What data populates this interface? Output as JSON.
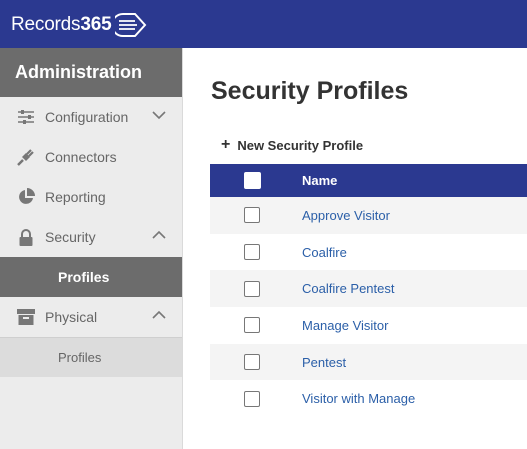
{
  "app": {
    "logo_text": "Records",
    "logo_number": "365"
  },
  "sidebar": {
    "heading": "Administration",
    "items": [
      {
        "label": "Configuration",
        "icon": "sliders-icon",
        "chevron": "down"
      },
      {
        "label": "Connectors",
        "icon": "plug-icon"
      },
      {
        "label": "Reporting",
        "icon": "pie-chart-icon"
      },
      {
        "label": "Security",
        "icon": "lock-icon",
        "chevron": "up"
      },
      {
        "label": "Profiles",
        "selected": true
      },
      {
        "label": "Physical",
        "icon": "archive-box-icon",
        "chevron": "up"
      },
      {
        "label": "Profiles"
      }
    ]
  },
  "main": {
    "title": "Security Profiles",
    "new_button_label": "New Security Profile",
    "table": {
      "columns": [
        "Name"
      ],
      "rows": [
        {
          "name": "Approve Visitor"
        },
        {
          "name": "Coalfire"
        },
        {
          "name": "Coalfire Pentest"
        },
        {
          "name": "Manage Visitor"
        },
        {
          "name": "Pentest"
        },
        {
          "name": "Visitor with Manage"
        }
      ]
    }
  },
  "colors": {
    "brand_navy": "#2b3990",
    "sidebar_dark": "#6c6c6c",
    "link_blue": "#2b5fa8"
  }
}
